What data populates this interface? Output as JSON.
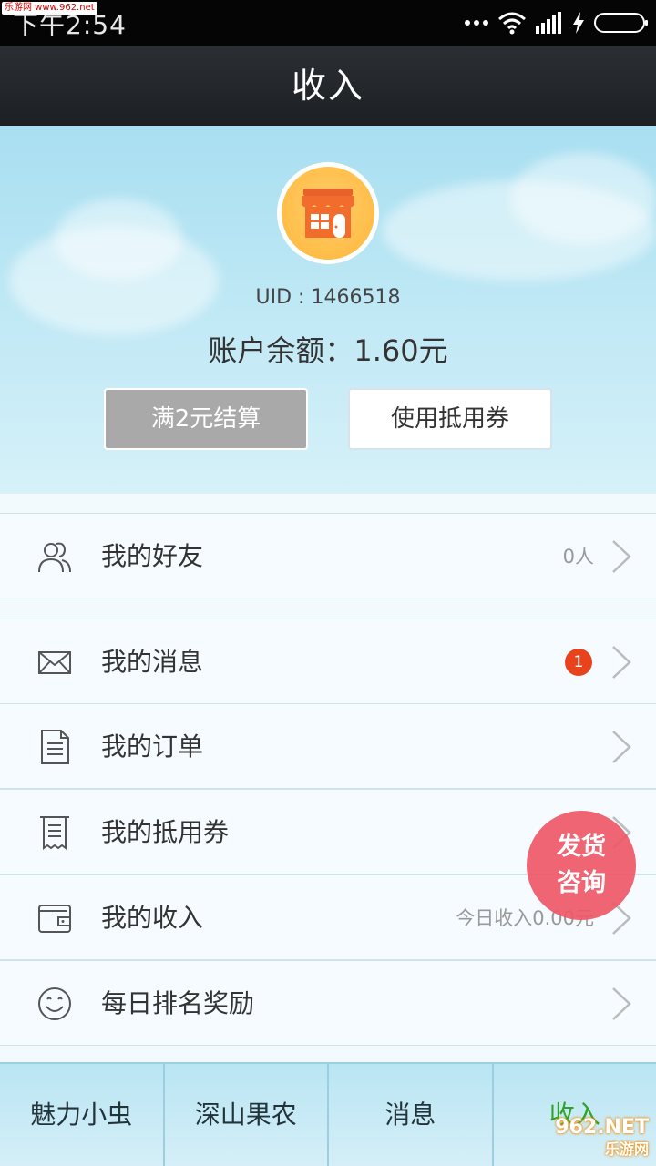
{
  "status_bar": {
    "time": "下午2:54",
    "watermark": "乐游网 www.962.net"
  },
  "title_bar": {
    "title": "收入"
  },
  "profile": {
    "uid_text": "UID : 1466518",
    "balance_text": "账户余额：1.60元",
    "settle_button": "满2元结算",
    "coupon_button": "使用抵用券"
  },
  "menu": {
    "friends": {
      "label": "我的好友",
      "value": "0人",
      "icon": "friends-icon"
    },
    "messages": {
      "label": "我的消息",
      "badge": "1",
      "icon": "envelope-icon"
    },
    "orders": {
      "label": "我的订单",
      "icon": "document-icon"
    },
    "coupons": {
      "label": "我的抵用券",
      "icon": "receipt-icon"
    },
    "income": {
      "label": "我的收入",
      "value": "今日收入0.00元",
      "icon": "wallet-icon"
    },
    "ranking": {
      "label": "每日排名奖励",
      "icon": "smile-icon"
    }
  },
  "float_consult": {
    "line1": "发货",
    "line2": "咨询"
  },
  "tabs": [
    {
      "label": "魅力小虫"
    },
    {
      "label": "深山果农"
    },
    {
      "label": "消息"
    },
    {
      "label": "收入"
    }
  ],
  "watermark_bottom": {
    "line1": "962.NET",
    "line2": "乐游网"
  },
  "colors": {
    "accent_green": "#2fa327",
    "badge_red": "#e8431c",
    "consult_pink": "#ee5868",
    "settle_gray": "#a9a9a9"
  }
}
